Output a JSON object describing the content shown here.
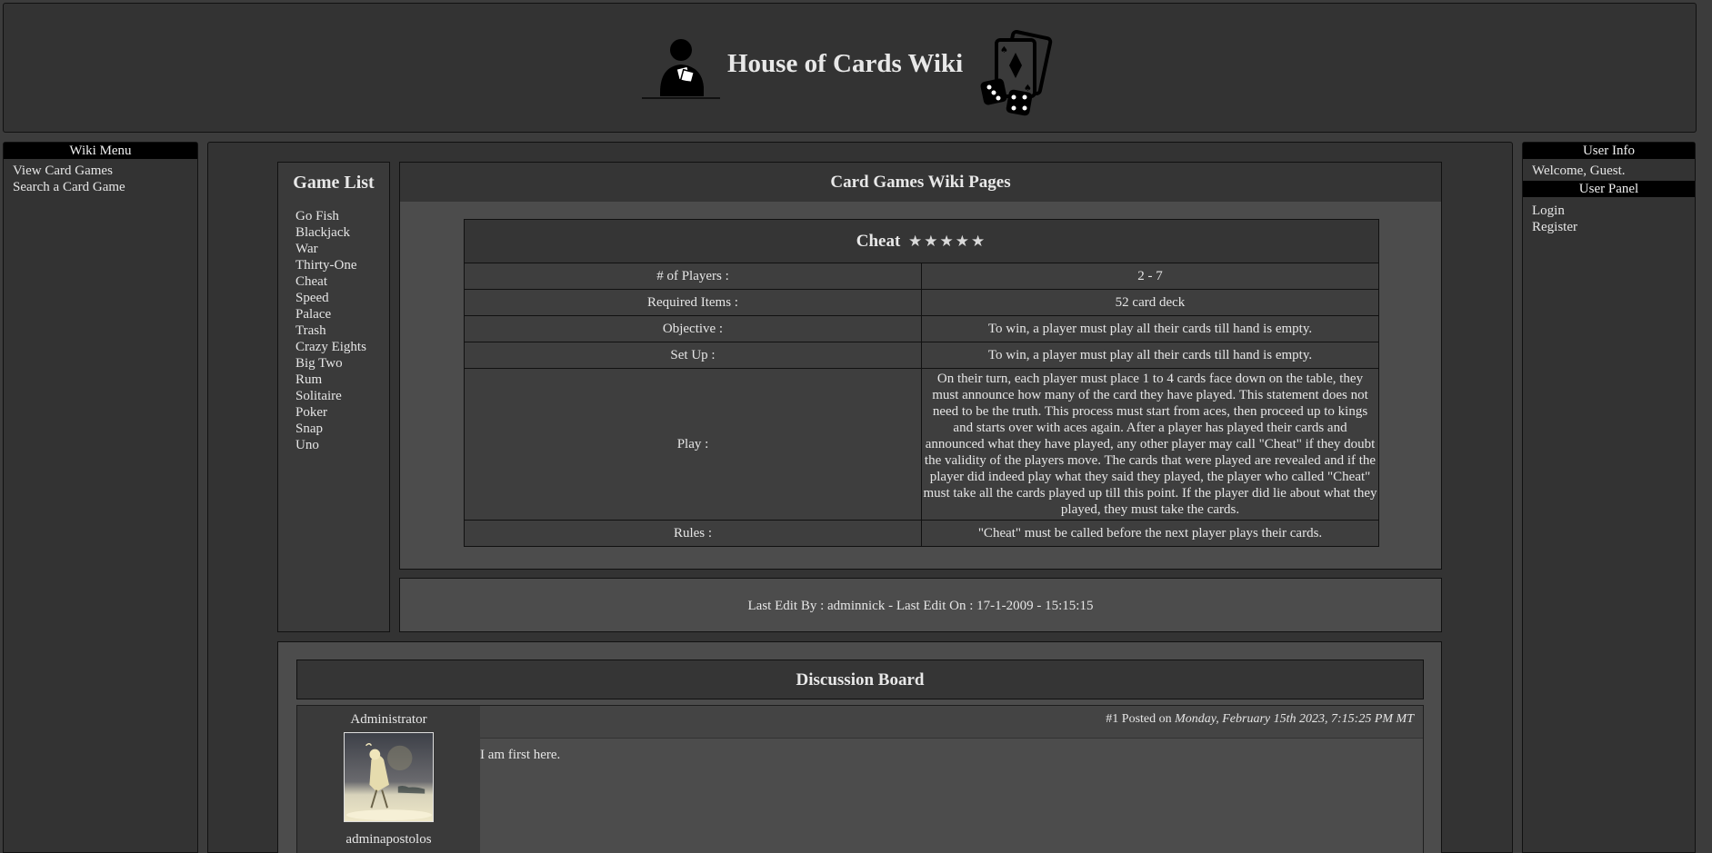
{
  "header": {
    "site_title": "House of Cards Wiki"
  },
  "left_sidebar": {
    "title": "Wiki Menu",
    "links": [
      "View Card Games",
      "Search a Card Game"
    ]
  },
  "right_sidebar": {
    "user_info_title": "User Info",
    "welcome_text": "Welcome, Guest.",
    "user_panel_title": "User Panel",
    "links": [
      "Login",
      "Register"
    ]
  },
  "game_list": {
    "title": "Game List",
    "games": [
      "Go Fish",
      "Blackjack",
      "War",
      "Thirty-One",
      "Cheat",
      "Speed",
      "Palace",
      "Trash",
      "Crazy Eights",
      "Big Two",
      "Rum",
      "Solitaire",
      "Poker",
      "Snap",
      "Uno"
    ]
  },
  "wiki": {
    "title": "Card Games Wiki Pages",
    "game_name": "Cheat",
    "stars": "★★★★★",
    "rating_stars": 5,
    "rows": [
      {
        "label": "# of Players :",
        "value": "2 - 7"
      },
      {
        "label": "Required Items :",
        "value": "52 card deck"
      },
      {
        "label": "Objective :",
        "value": "To win, a player must play all their cards till hand is empty."
      },
      {
        "label": "Set Up :",
        "value": "To win, a player must play all their cards till hand is empty."
      },
      {
        "label": "Play :",
        "value": "On their turn, each player must place 1 to 4 cards face down on the table, they must announce how many of the card they have played. This statement does not need to be the truth. This process must start from aces, then proceed up to kings and starts over with aces again. After a player has played their cards and announced what they have played, any other player may call \"Cheat\" if they doubt the validity of the players move. The cards that were played are revealed and if the player did indeed play what they said they played, the player who called \"Cheat\" must take all the cards played up till this point. If the player did lie about what they played, they must take the cards."
      },
      {
        "label": "Rules :",
        "value": "\"Cheat\" must be called before the next player plays their cards."
      }
    ],
    "last_edit": "Last Edit By : adminnick - Last Edit On : 17-1-2009 - 15:15:15"
  },
  "discussion": {
    "title": "Discussion Board",
    "post": {
      "author_role": "Administrator",
      "author_name": "adminapostolos",
      "post_number": "#1 Posted on",
      "post_date": "Monday, February 15th 2023, 7:15:25 PM MT",
      "body": "I am first here."
    }
  }
}
